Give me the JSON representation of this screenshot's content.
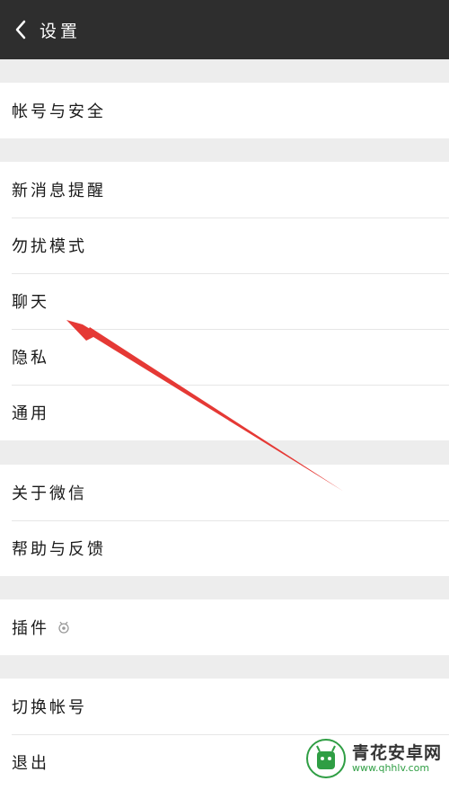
{
  "header": {
    "title": "设置",
    "back_icon": "chevron-left-icon"
  },
  "groups": [
    {
      "items": [
        "帐号与安全"
      ]
    },
    {
      "items": [
        "新消息提醒",
        "勿扰模式",
        "聊天",
        "隐私",
        "通用"
      ]
    },
    {
      "items": [
        "关于微信",
        "帮助与反馈"
      ]
    },
    {
      "items": [
        "插件"
      ]
    },
    {
      "items": [
        "切换帐号",
        "退出"
      ]
    }
  ],
  "annotation": {
    "color": "#e53935",
    "points_to": "聊天"
  },
  "watermark": {
    "name": "青花安卓网",
    "url": "www.qhhlv.com",
    "color": "#2f9e44"
  }
}
